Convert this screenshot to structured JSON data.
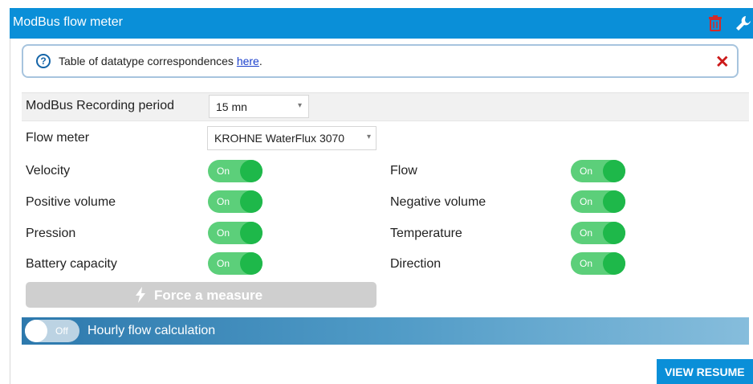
{
  "header": {
    "title": "ModBus flow meter",
    "accent_color": "#0a8fd8",
    "trash_icon": "trash-icon",
    "wrench_icon": "wrench-icon"
  },
  "info": {
    "icon": "help-circle-icon",
    "text": "Table of datatype correspondences ",
    "link": "here",
    "suffix": ".",
    "close_icon": "close-icon"
  },
  "recording": {
    "label": "ModBus Recording period",
    "value": "15 mn"
  },
  "flow_meter": {
    "label": "Flow meter",
    "value": "KROHNE WaterFlux 3070"
  },
  "switches": [
    {
      "label": "Velocity",
      "state": "On"
    },
    {
      "label": "Flow",
      "state": "On"
    },
    {
      "label": "Positive volume",
      "state": "On"
    },
    {
      "label": "Negative volume",
      "state": "On"
    },
    {
      "label": "Pression",
      "state": "On"
    },
    {
      "label": "Temperature",
      "state": "On"
    },
    {
      "label": "Battery capacity",
      "state": "On"
    },
    {
      "label": "Direction",
      "state": "On"
    }
  ],
  "force_button": {
    "label": "Force a measure",
    "icon": "lightning-icon"
  },
  "hourly": {
    "state": "Off",
    "label": "Hourly flow calculation"
  },
  "resume_button": {
    "label": "VIEW RESUME"
  }
}
